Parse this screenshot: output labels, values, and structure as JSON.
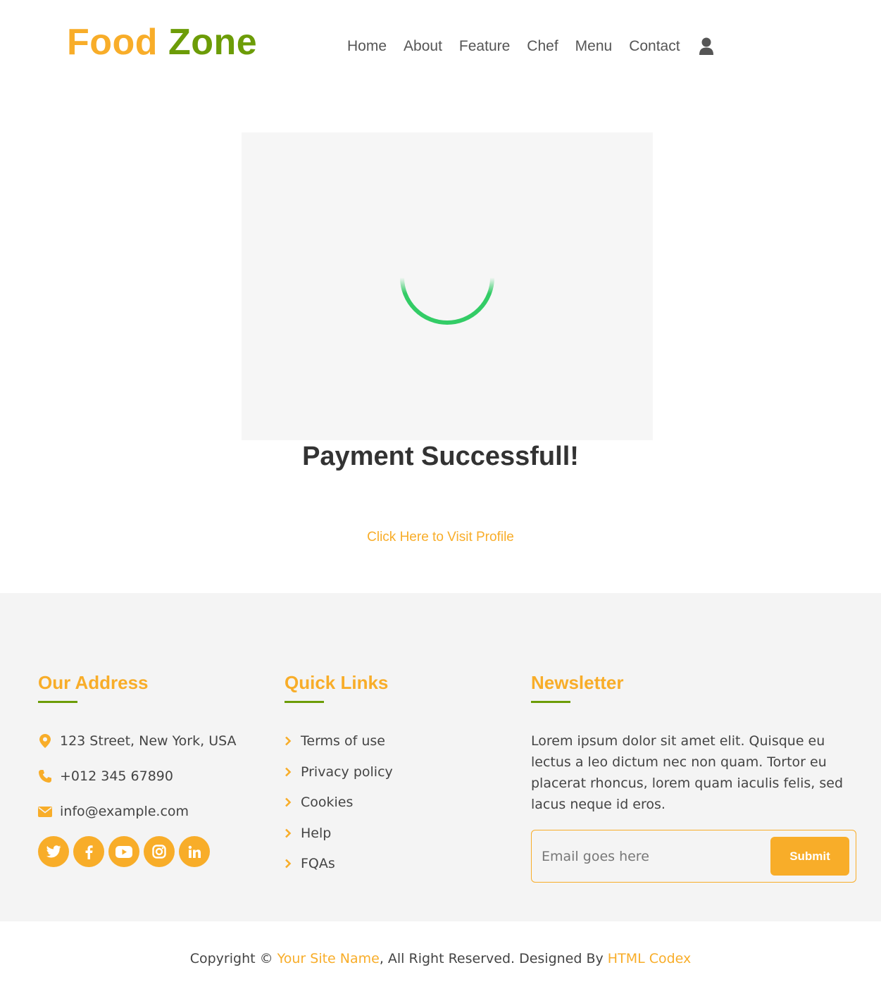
{
  "brand": {
    "part1": "Food",
    "part2": "Zone"
  },
  "nav": {
    "items": [
      "Home",
      "About",
      "Feature",
      "Chef",
      "Menu",
      "Contact"
    ],
    "user_icon": "user-icon"
  },
  "main": {
    "spinner_color": "#33cc66",
    "title": "Payment Successfull!",
    "profile_link": "Click Here to Visit Profile"
  },
  "footer": {
    "address": {
      "heading": "Our Address",
      "street": "123 Street, New York, USA",
      "phone": "+012 345 67890",
      "email": "info@example.com",
      "socials": [
        "twitter-icon",
        "facebook-icon",
        "youtube-icon",
        "instagram-icon",
        "linkedin-icon"
      ]
    },
    "quick_links": {
      "heading": "Quick Links",
      "items": [
        "Terms of use",
        "Privacy policy",
        "Cookies",
        "Help",
        "FQAs"
      ]
    },
    "newsletter": {
      "heading": "Newsletter",
      "text": "Lorem ipsum dolor sit amet elit. Quisque eu lectus a leo dictum nec non quam. Tortor eu placerat rhoncus, lorem quam iaculis felis, sed lacus neque id eros.",
      "placeholder": "Email goes here",
      "submit": "Submit"
    }
  },
  "copyright": {
    "prefix": "Copyright © ",
    "site_name": "Your Site Name",
    "middle": ", All Right Reserved. Designed By ",
    "designer": "HTML Codex"
  },
  "colors": {
    "accent": "#f8ad29",
    "brand_green": "#6c9c07"
  }
}
